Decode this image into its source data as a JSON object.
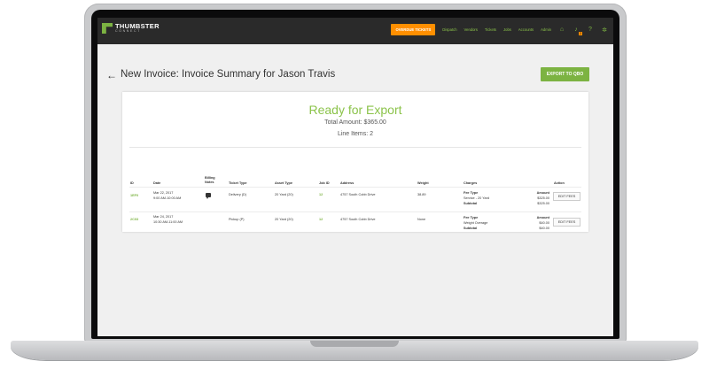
{
  "header": {
    "logo_name": "THUMBSTER",
    "logo_sub": "CONNECT",
    "overdue_label": "OVERDUE TICKETS",
    "nav_items": [
      "Dispatch",
      "Vendors",
      "Tickets",
      "Jobs",
      "Accounts",
      "Admin"
    ],
    "notification_count": "2"
  },
  "page": {
    "title": "New Invoice: Invoice Summary for Jason Travis",
    "export_label": "EXPORT TO QBO"
  },
  "summary": {
    "status": "Ready for Export",
    "total": "Total Amount: $365.00",
    "line_items": "Line Items: 2"
  },
  "table": {
    "headers": {
      "id": "ID",
      "date": "Date",
      "billing_notes_1": "Billing",
      "billing_notes_2": "Notes",
      "ticket_type": "Ticket Type",
      "asset_type": "Asset Type",
      "job_id": "Job ID",
      "address": "Address",
      "weight": "Weight",
      "charges": "Charges",
      "action": "Action"
    },
    "rows": [
      {
        "id": "1EF0",
        "date": "Mar 22, 2017",
        "time": "9:00 AM-10:00 AM",
        "ticket_type": "Delivery (D)",
        "asset_type": "20 Yard (20)",
        "job_id": "12",
        "address": "4757 South Cobb Drive",
        "weight": "38.89",
        "fee_type_label": "Fee Type",
        "amount_label": "Amount",
        "fee_name": "Service - 20 Yard",
        "fee_amount": "$325.00",
        "subtotal_label": "Subtotal",
        "subtotal": "$325.00",
        "action_label": "EDIT FEES"
      },
      {
        "id": "2C03",
        "date": "Mar 24, 2017",
        "time": "10:30 AM-11:00 AM",
        "ticket_type": "Pickup (P)",
        "asset_type": "20 Yard (20)",
        "job_id": "12",
        "address": "4757 South Cobb Drive",
        "weight": "None",
        "fee_type_label": "Fee Type",
        "amount_label": "Amount",
        "fee_name": "Weight Overage",
        "fee_amount": "$40.00",
        "subtotal_label": "Subtotal",
        "subtotal": "$40.00",
        "action_label": "EDIT FEES"
      }
    ]
  },
  "colors": {
    "accent_green": "#8bc34a",
    "accent_orange": "#ff8f00",
    "topbar": "#2a2a2a"
  }
}
